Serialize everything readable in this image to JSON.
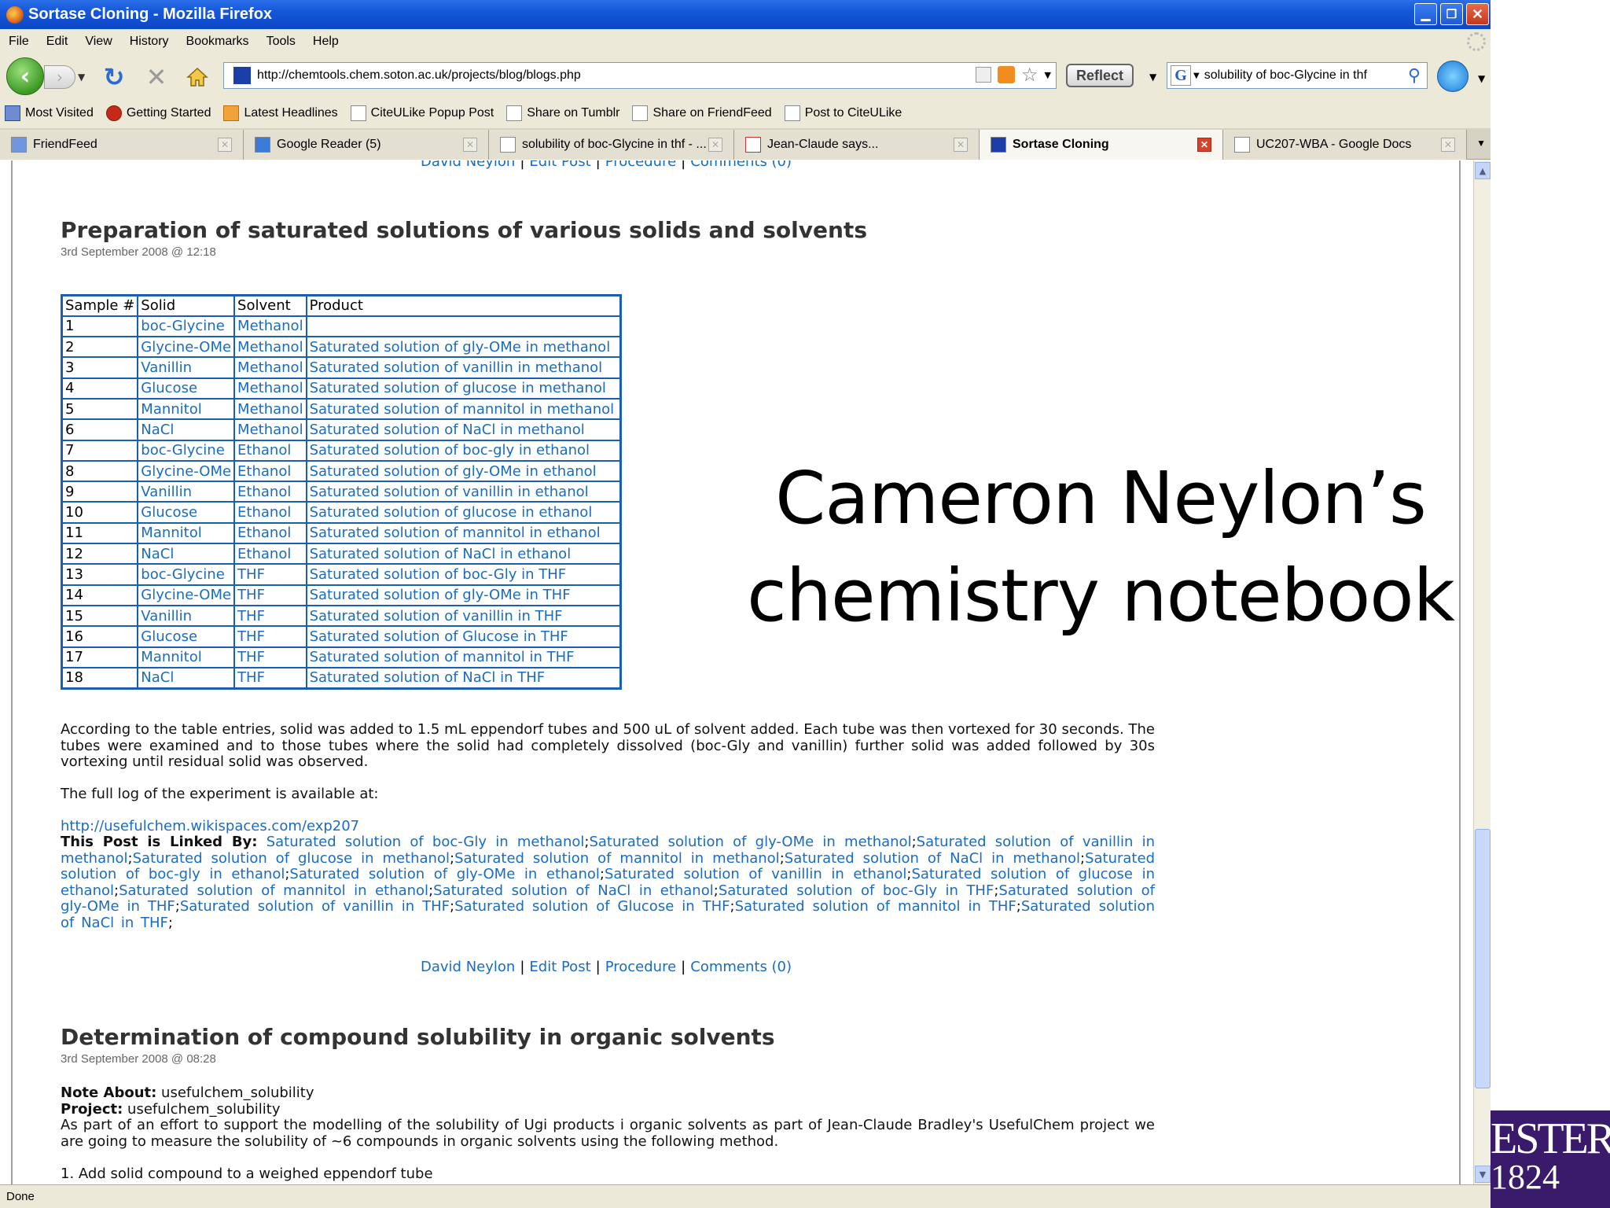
{
  "window": {
    "title": "Sortase Cloning - Mozilla Firefox"
  },
  "menu": [
    "File",
    "Edit",
    "View",
    "History",
    "Bookmarks",
    "Tools",
    "Help"
  ],
  "nav": {
    "url": "http://chemtools.chem.soton.ac.uk/projects/blog/blogs.php",
    "reflect_label": "Reflect",
    "search_value": "solubility of boc-Glycine in thf",
    "search_engine": "G"
  },
  "bookmarks": [
    "Most Visited",
    "Getting Started",
    "Latest Headlines",
    "CiteULike Popup Post",
    "Share on Tumblr",
    "Share on FriendFeed",
    "Post to CiteULike"
  ],
  "tabs": [
    "FriendFeed",
    "Google Reader (5)",
    "solubility of boc-Glycine in thf - ...",
    "Jean-Claude says...",
    "Sortase Cloning",
    "UC207-WBA - Google Docs"
  ],
  "post_links": {
    "author": "David Neylon",
    "edit": "Edit Post",
    "procedure": "Procedure",
    "comments": "Comments (0)"
  },
  "post1": {
    "title": "Preparation of saturated solutions of various solids and solvents",
    "date": "3rd September 2008 @ 12:18",
    "table_headers": [
      "Sample #",
      "Solid",
      "Solvent",
      "Product"
    ],
    "table_rows": [
      [
        "1",
        "boc-Glycine",
        "Methanol",
        ""
      ],
      [
        "2",
        "Glycine-OMe",
        "Methanol",
        "Saturated solution of gly-OMe in methanol"
      ],
      [
        "3",
        "Vanillin",
        "Methanol",
        "Saturated solution of vanillin in methanol"
      ],
      [
        "4",
        "Glucose",
        "Methanol",
        "Saturated solution of glucose in methanol"
      ],
      [
        "5",
        "Mannitol",
        "Methanol",
        "Saturated solution of mannitol in methanol"
      ],
      [
        "6",
        "NaCl",
        "Methanol",
        "Saturated solution of NaCl in methanol"
      ],
      [
        "7",
        "boc-Glycine",
        "Ethanol",
        "Saturated solution of boc-gly in ethanol"
      ],
      [
        "8",
        "Glycine-OMe",
        "Ethanol",
        "Saturated solution of gly-OMe in ethanol"
      ],
      [
        "9",
        "Vanillin",
        "Ethanol",
        "Saturated solution of vanillin in ethanol"
      ],
      [
        "10",
        "Glucose",
        "Ethanol",
        "Saturated solution of glucose in ethanol"
      ],
      [
        "11",
        "Mannitol",
        "Ethanol",
        "Saturated solution of mannitol in ethanol"
      ],
      [
        "12",
        "NaCl",
        "Ethanol",
        "Saturated solution of NaCl in ethanol"
      ],
      [
        "13",
        "boc-Glycine",
        "THF",
        "Saturated solution of boc-Gly in THF"
      ],
      [
        "14",
        "Glycine-OMe",
        "THF",
        "Saturated solution of gly-OMe in THF"
      ],
      [
        "15",
        "Vanillin",
        "THF",
        "Saturated solution of vanillin in THF"
      ],
      [
        "16",
        "Glucose",
        "THF",
        "Saturated solution of Glucose in THF"
      ],
      [
        "17",
        "Mannitol",
        "THF",
        "Saturated solution of mannitol in THF"
      ],
      [
        "18",
        "NaCl",
        "THF",
        "Saturated solution of NaCl in THF"
      ]
    ],
    "paragraph": "According to the table entries, solid was added to 1.5 mL eppendorf tubes and 500 uL of solvent added. Each tube was then vortexed for 30 seconds. The tubes were examined and to those tubes where the solid had completely dissolved (boc-Gly and vanillin) further solid was added followed by 30s vortexing until residual solid was observed.",
    "log_intro": "The full log of the experiment is available at:",
    "log_url": "http://usefulchem.wikispaces.com/exp207",
    "linked_by_label": "This Post is Linked By:",
    "linked_by": [
      "Saturated solution of boc-Gly in methanol",
      "Saturated solution of gly-OMe in methanol",
      "Saturated solution of vanillin in methanol",
      "Saturated solution of glucose in methanol",
      "Saturated solution of mannitol in methanol",
      "Saturated solution of NaCl in methanol",
      "Saturated solution of boc-gly in ethanol",
      "Saturated solution of gly-OMe in ethanol",
      "Saturated solution of vanillin in ethanol",
      "Saturated solution of glucose in ethanol",
      "Saturated solution of mannitol in ethanol",
      "Saturated solution of NaCl in ethanol",
      "Saturated solution of boc-Gly in THF",
      "Saturated solution of gly-OMe in THF",
      "Saturated solution of vanillin in THF",
      "Saturated solution of Glucose in THF",
      "Saturated solution of mannitol in THF",
      "Saturated solution of NaCl in THF"
    ]
  },
  "post2": {
    "title": "Determination of compound solubility in organic solvents",
    "date": "3rd September 2008 @ 08:28",
    "note_label": "Note About:",
    "note_value": "usefulchem_solubility",
    "project_label": "Project:",
    "project_value": "usefulchem_solubility",
    "paragraph": "As part of an effort to support the modelling of the solubility of Ugi products i organic solvents as part of Jean-Claude Bradley's UsefulChem project we are going to measure the solubility of ~6 compounds in organic solvents using the following method.",
    "step1": "1. Add solid compound to a weighed eppendorf tube"
  },
  "overlay": {
    "line1": "Cameron Neylon’s",
    "line2": "chemistry notebook"
  },
  "status": "Done",
  "logo": {
    "line1": "ESTER",
    "line2": "1824",
    "color": "#3a1a6a"
  }
}
